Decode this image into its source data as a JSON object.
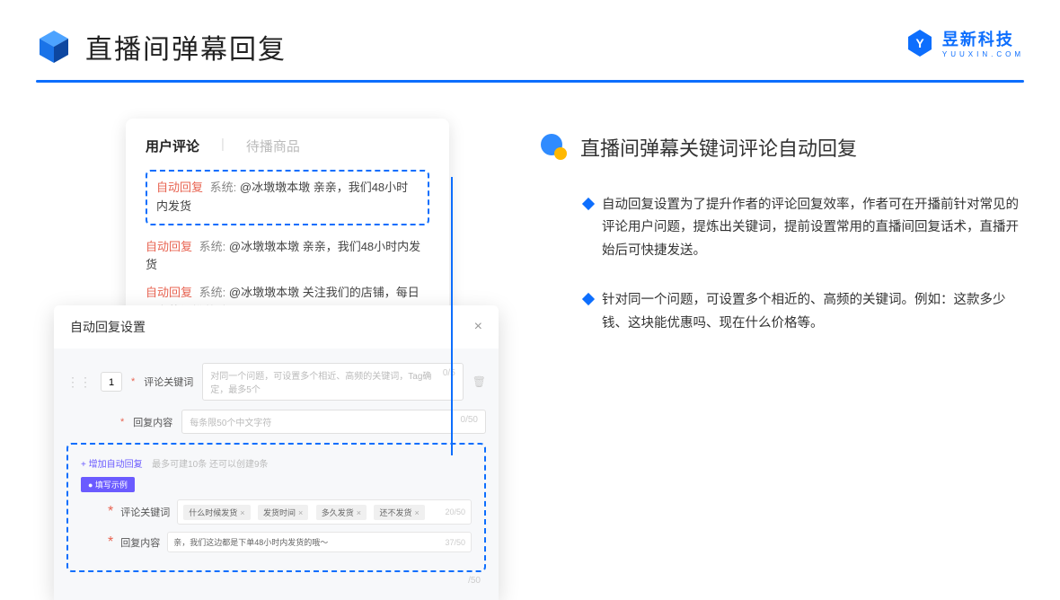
{
  "header": {
    "title": "直播间弹幕回复"
  },
  "brand": {
    "name": "昱新科技",
    "sub": "YUUXIN.COM"
  },
  "comments": {
    "tab_active": "用户评论",
    "tab_inactive": "待播商品",
    "rows": [
      "自动回复 系统: @冰墩墩本墩 亲亲，我们48小时内发货",
      "自动回复 系统: @冰墩墩本墩 亲亲，我们48小时内发货",
      "自动回复 系统: @冰墩墩本墩 关注我们的店铺，每日都有热门推荐呦～"
    ],
    "badge": "自动回复",
    "sys": "系统:",
    "r1_rest": " @冰墩墩本墩 亲亲，我们48小时内发货",
    "r2_rest": " @冰墩墩本墩 亲亲，我们48小时内发货",
    "r3_rest": " @冰墩墩本墩 关注我们的店铺，每日都有热门推荐呦～"
  },
  "settings": {
    "title": "自动回复设置",
    "num": "1",
    "keyword_label": "评论关键词",
    "keyword_ph": "对同一个问题，可设置多个相近、高频的关键词，Tag确定，最多5个",
    "keyword_count": "0/5",
    "content_label": "回复内容",
    "content_ph": "每条限50个中文字符",
    "content_count": "0/50",
    "add_link": "+ 增加自动回复",
    "add_hint": "最多可建10条 还可以创建9条",
    "example_badge": "● 填写示例",
    "ex_kw_label": "评论关键词",
    "ex_tags": [
      "什么时候发货",
      "发货时间",
      "多久发货",
      "还不发货"
    ],
    "ex_kw_count": "20/50",
    "ex_content_label": "回复内容",
    "ex_content_val": "亲，我们这边都是下单48小时内发货的哦～",
    "ex_content_count": "37/50",
    "tail_count": "/50"
  },
  "right": {
    "subtitle": "直播间弹幕关键词评论自动回复",
    "bullet1": "自动回复设置为了提升作者的评论回复效率，作者可在开播前针对常见的评论用户问题，提炼出关键词，提前设置常用的直播间回复话术，直播开始后可快捷发送。",
    "bullet2": "针对同一个问题，可设置多个相近的、高频的关键词。例如：这款多少钱、这块能优惠吗、现在什么价格等。"
  }
}
